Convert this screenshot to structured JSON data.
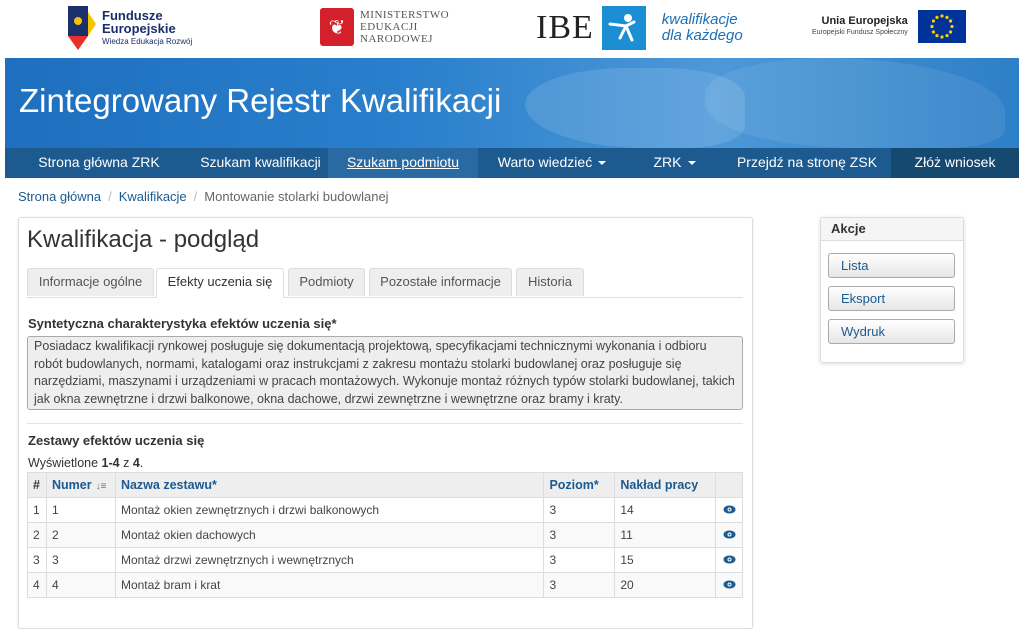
{
  "logos": {
    "fe_line1": "Fundusze",
    "fe_line2": "Europejskie",
    "fe_line3": "Wiedza Edukacja Rozwój",
    "men_line1": "MINISTERSTWO",
    "men_line2": "EDUKACJI",
    "men_line3": "NARODOWEJ",
    "ibe": "IBE",
    "ibe_sub1": "kwalifikacje",
    "ibe_sub2": "dla każdego",
    "ue_line1": "Unia Europejska",
    "ue_line2": "Europejski Fundusz Społeczny"
  },
  "banner": {
    "title": "Zintegrowany Rejestr Kwalifikacji"
  },
  "nav": {
    "items": [
      {
        "label": "Strona główna ZRK"
      },
      {
        "label": "Szukam kwalifikacji"
      },
      {
        "label": "Szukam podmiotu"
      },
      {
        "label": "Warto wiedzieć"
      },
      {
        "label": "ZRK"
      },
      {
        "label": "Przejdź na stronę ZSK"
      },
      {
        "label": "Złóż wniosek"
      }
    ]
  },
  "breadcrumb": {
    "items": [
      "Strona główna",
      "Kwalifikacje",
      "Montowanie stolarki budowlanej"
    ],
    "separator": "/"
  },
  "panel": {
    "title": "Kwalifikacja - podgląd",
    "tabs": [
      {
        "label": "Informacje ogólne"
      },
      {
        "label": "Efekty uczenia się"
      },
      {
        "label": "Podmioty"
      },
      {
        "label": "Pozostałe informacje"
      },
      {
        "label": "Historia"
      }
    ],
    "synthetic_label": "Syntetyczna charakterystyka efektów uczenia się*",
    "synthetic_text": "Posiadacz kwalifikacji rynkowej posługuje się dokumentacją projektową, specyfikacjami technicznymi wykonania i odbioru robót budowlanych, normami, katalogami oraz instrukcjami z zakresu montażu stolarki budowlanej oraz posługuje się narzędziami, maszynami i urządzeniami w pracach montażowych. Wykonuje montaż różnych typów stolarki budowlanej, takich jak okna zewnętrzne i drzwi balkonowe, okna dachowe, drzwi zewnętrzne i wewnętrzne oraz bramy i kraty.",
    "sets_title": "Zestawy efektów uczenia się",
    "shown_prefix": "Wyświetlone ",
    "shown_range": "1-4",
    "shown_mid": " z ",
    "shown_total": "4",
    "shown_suffix": ".",
    "table": {
      "headers": [
        "#",
        "Numer",
        "Nazwa zestawu*",
        "Poziom*",
        "Nakład pracy",
        ""
      ],
      "rows": [
        {
          "idx": "1",
          "numer": "1",
          "nazwa": "Montaż okien zewnętrznych i drzwi balkonowych",
          "poziom": "3",
          "naklad": "14"
        },
        {
          "idx": "2",
          "numer": "2",
          "nazwa": "Montaż okien dachowych",
          "poziom": "3",
          "naklad": "11"
        },
        {
          "idx": "3",
          "numer": "3",
          "nazwa": "Montaż drzwi zewnętrznych i wewnętrznych",
          "poziom": "3",
          "naklad": "15"
        },
        {
          "idx": "4",
          "numer": "4",
          "nazwa": "Montaż bram i krat",
          "poziom": "3",
          "naklad": "20"
        }
      ]
    }
  },
  "akcje": {
    "title": "Akcje",
    "buttons": [
      {
        "label": "Lista"
      },
      {
        "label": "Eksport"
      },
      {
        "label": "Wydruk"
      }
    ]
  },
  "colors": {
    "nav_bg": "#1c5a8f",
    "banner_bg": "#2a80cc",
    "link": "#1c5a8f"
  }
}
